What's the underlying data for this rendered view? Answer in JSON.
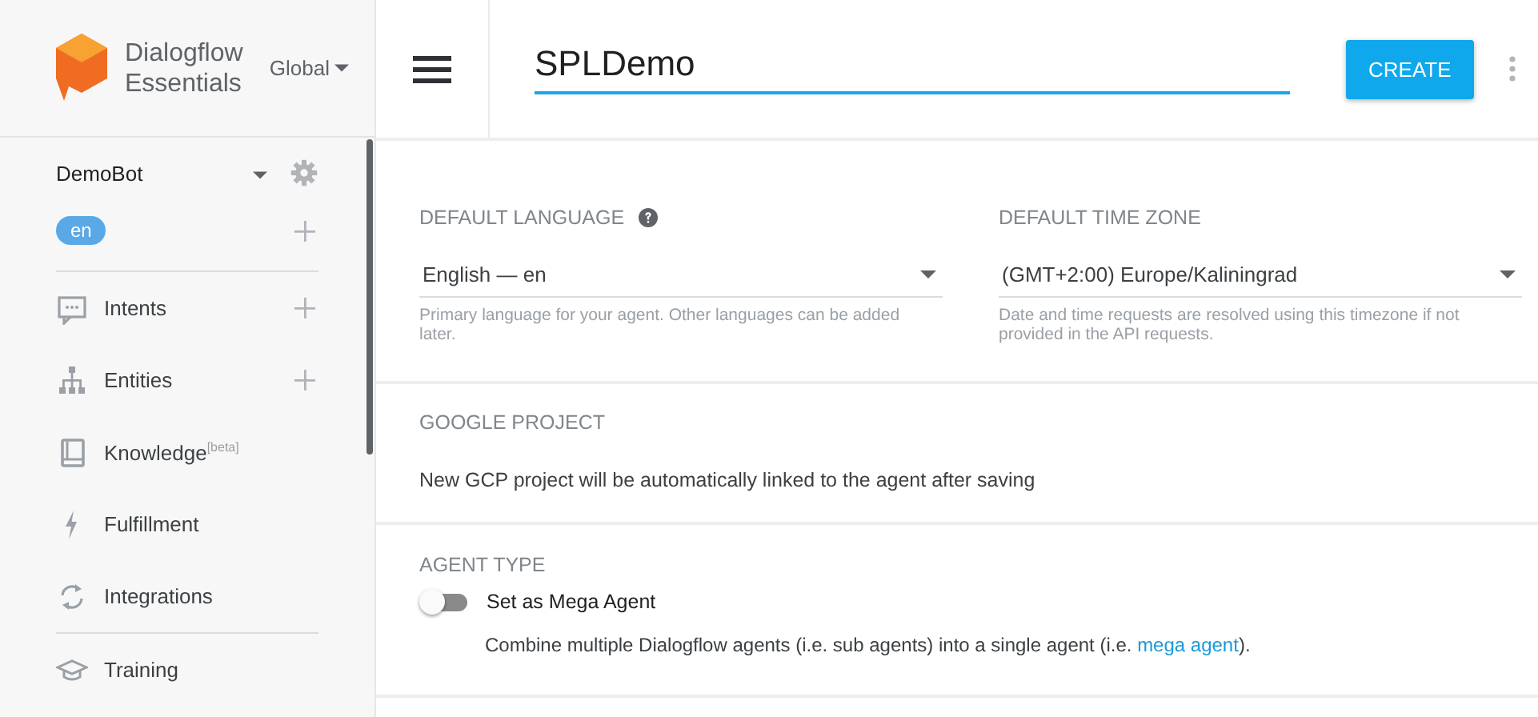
{
  "brand": {
    "name_lines": [
      "Dialogflow",
      "Essentials"
    ],
    "region": "Global"
  },
  "agent": {
    "name": "DemoBot",
    "language": "en"
  },
  "nav": [
    {
      "label": "Intents",
      "add": true
    },
    {
      "label": "Entities",
      "add": true
    },
    {
      "label": "Knowledge$^{[beta]}$",
      "add": false
    },
    {
      "label": "Fulfillment",
      "add": false
    },
    {
      "label": "Integrations",
      "add": false
    },
    {
      "label": "Training",
      "add": false
    }
  ],
  "header": {
    "agent_name": "SPLDemo",
    "button": "CREATE"
  },
  "language": {
    "label": "DEFAULT LANGUAGE",
    "value": "English — en",
    "hint": "Primary language for your agent. Other languages can be added later."
  },
  "timezone": {
    "label": "DEFAULT TIME ZONE",
    "value": "(GMT+2:00) Europe/Kaliningrad",
    "hint": "Date and time requests are resolved using this timezone if not provided in the API requests."
  },
  "google_project": {
    "label": "GOOGLE PROJECT",
    "text": "New GCP project will be automatically linked to the agent after saving"
  },
  "agent_type": {
    "label": "AGENT TYPE",
    "toggle_label": "Set as Mega Agent",
    "on": false,
    "description": "Combine multiple Dialogflow agents (i.e. sub agents) into a single agent (i.e. ",
    "link": "mega agent",
    "after_link": ")."
  }
}
